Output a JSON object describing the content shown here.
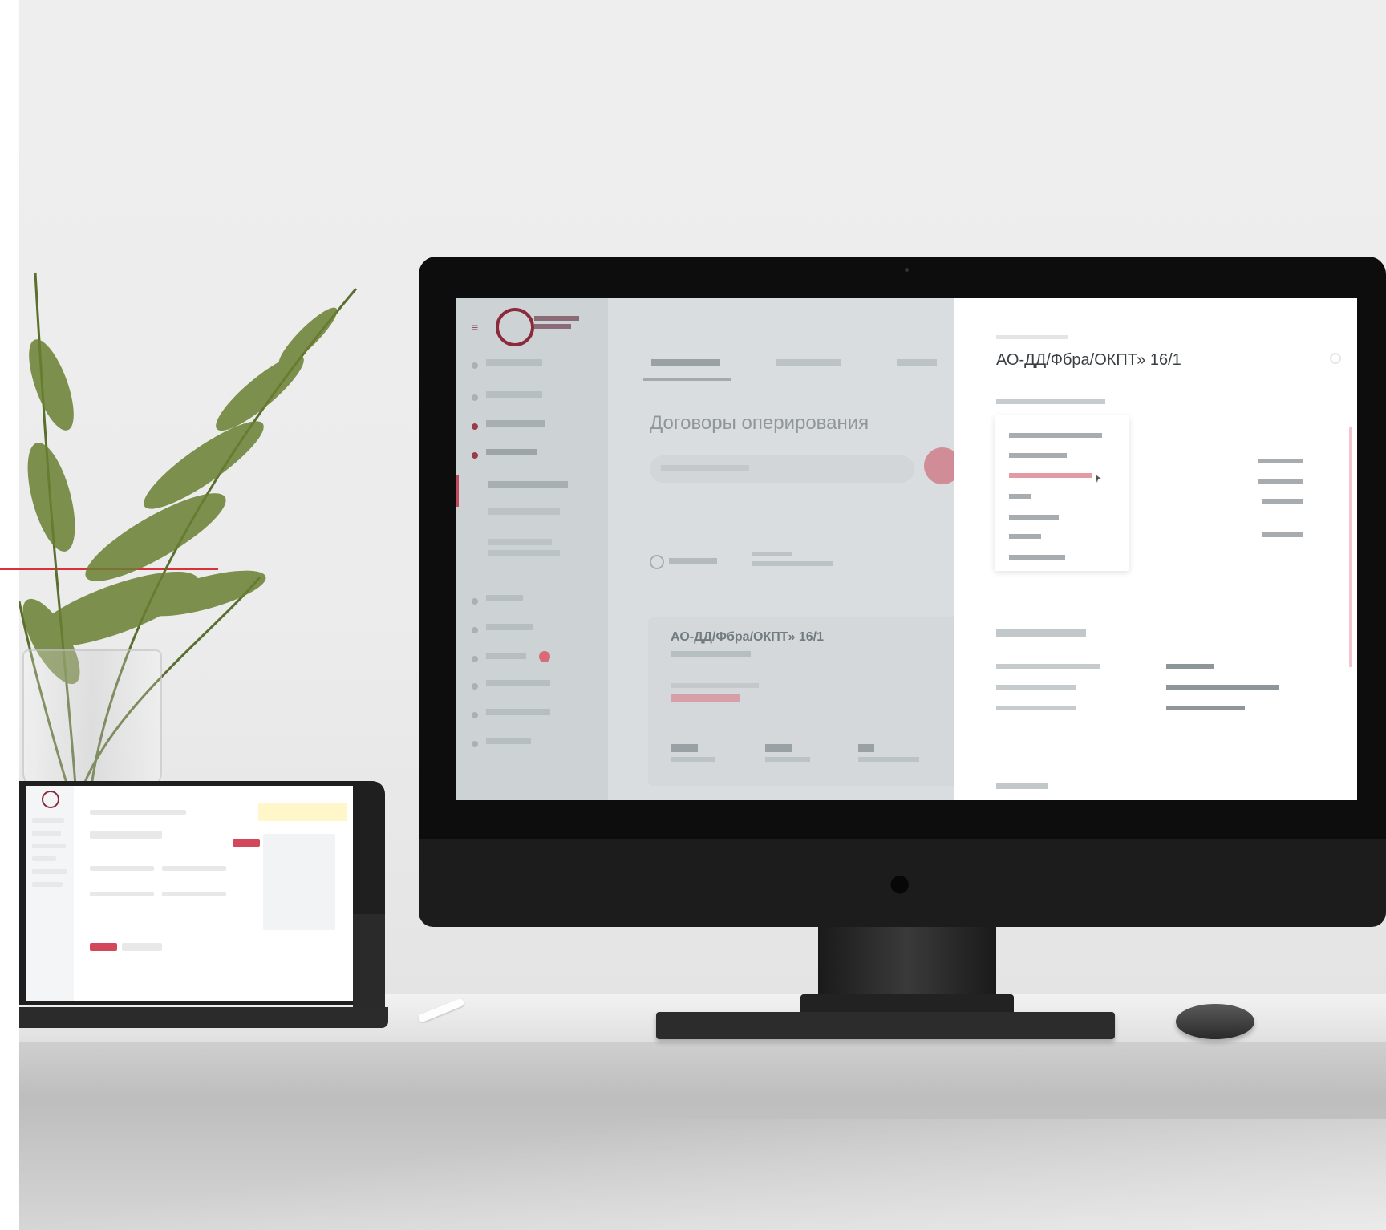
{
  "scene": {
    "accent_color": "#d8313c",
    "brand_color": "#d2485a"
  },
  "imac": {
    "logo": {
      "icon": "company-logo"
    },
    "sidebar": {
      "items": [
        {
          "icon": "dashboard-icon"
        },
        {
          "icon": "analytics-icon"
        },
        {
          "icon": "documents-icon"
        },
        {
          "icon": "contracts-icon"
        },
        {
          "icon": "submenu-item"
        },
        {
          "icon": "submenu-item"
        },
        {
          "icon": "submenu-item"
        },
        {
          "icon": "folder-icon"
        },
        {
          "icon": "finance-icon"
        },
        {
          "icon": "alerts-icon"
        },
        {
          "icon": "settings-icon"
        },
        {
          "icon": "users-icon"
        },
        {
          "icon": "reports-icon"
        }
      ]
    },
    "main": {
      "title": "Договоры оперирования",
      "card": {
        "title": "АО-ДД/Фбра/ОКПТ» 16/1"
      }
    },
    "detail": {
      "title": "АО-ДД/Фбра/ОКПТ» 16/1",
      "dropdown_items": [
        {
          "active": false
        },
        {
          "active": false
        },
        {
          "active": true
        },
        {
          "active": false
        },
        {
          "active": false
        },
        {
          "active": false
        },
        {
          "active": false
        }
      ]
    }
  },
  "apple_logo": ""
}
